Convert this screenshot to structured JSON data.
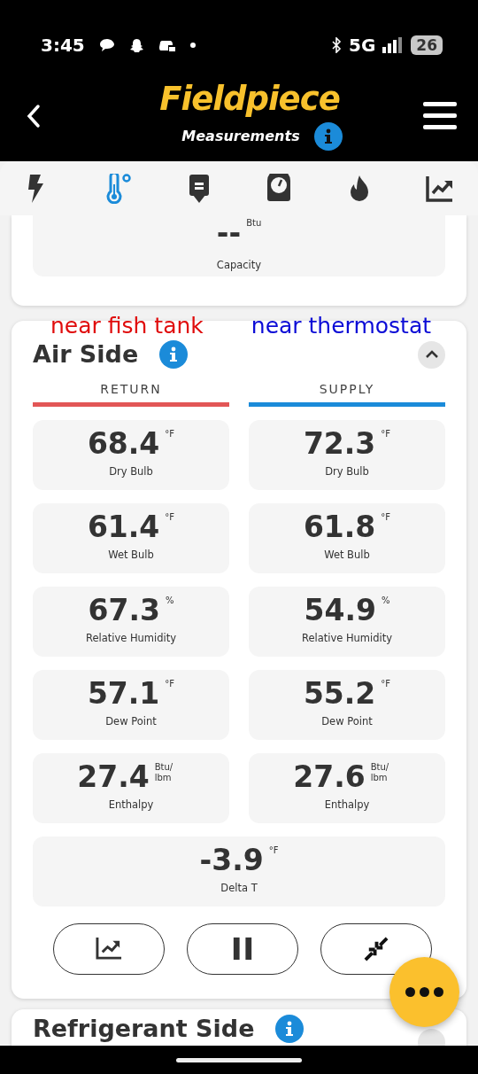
{
  "status_bar": {
    "time": "3:45",
    "network": "5G",
    "battery": "26"
  },
  "header": {
    "logo": "Fieldpiece",
    "subtitle": "Measurements"
  },
  "tabs": [
    {
      "kind": "bolt",
      "selected": false
    },
    {
      "kind": "thermometer",
      "selected": true
    },
    {
      "kind": "probe",
      "selected": false
    },
    {
      "kind": "gauge",
      "selected": false
    },
    {
      "kind": "flame",
      "selected": false
    },
    {
      "kind": "chart",
      "selected": false
    }
  ],
  "capacity": {
    "value": "--",
    "unit": "Btu",
    "label": "Capacity"
  },
  "air_side": {
    "annotations": [
      {
        "text": "near fish tank",
        "color": "#e00c0c"
      },
      {
        "text": "near thermostat",
        "color": "#0b0bd6"
      }
    ],
    "title": "Air Side",
    "expanded": true,
    "columns": [
      {
        "label": "RETURN",
        "color": "#e25656"
      },
      {
        "label": "SUPPLY",
        "color": "#1b8bd9"
      }
    ],
    "rows": [
      [
        {
          "value": "68.4",
          "unit": "°F",
          "label": "Dry Bulb"
        },
        {
          "value": "72.3",
          "unit": "°F",
          "label": "Dry Bulb"
        }
      ],
      [
        {
          "value": "61.4",
          "unit": "°F",
          "label": "Wet Bulb"
        },
        {
          "value": "61.8",
          "unit": "°F",
          "label": "Wet Bulb"
        }
      ],
      [
        {
          "value": "67.3",
          "unit": "%",
          "label": "Relative Humidity"
        },
        {
          "value": "54.9",
          "unit": "%",
          "label": "Relative Humidity"
        }
      ],
      [
        {
          "value": "57.1",
          "unit": "°F",
          "label": "Dew Point"
        },
        {
          "value": "55.2",
          "unit": "°F",
          "label": "Dew Point"
        }
      ],
      [
        {
          "value": "27.4",
          "unit": "Btu/ lbm",
          "label": "Enthalpy"
        },
        {
          "value": "27.6",
          "unit": "Btu/ lbm",
          "label": "Enthalpy"
        }
      ]
    ],
    "delta": {
      "value": "-3.9",
      "unit": "°F",
      "label": "Delta T"
    },
    "buttons": [
      {
        "kind": "chart"
      },
      {
        "kind": "pause"
      },
      {
        "kind": "collapse"
      }
    ]
  },
  "next_section": {
    "title": "Refrigerant Side"
  }
}
